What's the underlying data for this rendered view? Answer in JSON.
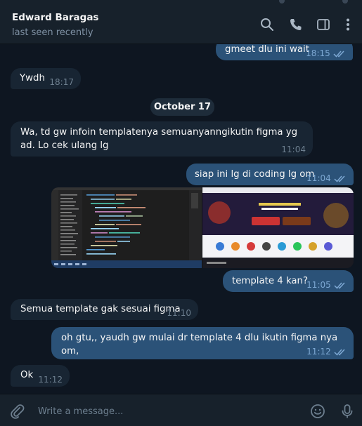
{
  "header": {
    "contact_name": "Edward Baragas",
    "status": "last seen recently",
    "icons": [
      "search-icon",
      "phone-icon",
      "sidebar-toggle-icon",
      "more-vertical-icon"
    ]
  },
  "chat": {
    "date_divider": "October 17",
    "messages": [
      {
        "direction": "outgoing",
        "text": "gmeet dlu ini wait",
        "time": "18:15",
        "read": true
      },
      {
        "direction": "incoming",
        "text": "Ywdh",
        "time": "18:17"
      },
      {
        "direction": "incoming",
        "text": "Wa, td gw infoin templatenya semuanyanngikutin figma yg ad. Lo cek ulang lg",
        "time": "11:04"
      },
      {
        "direction": "outgoing",
        "text": "siap ini lg di coding lg om",
        "time": "11:04",
        "read": true
      },
      {
        "direction": "outgoing",
        "type": "image",
        "description": "two screenshots: code editor and website page"
      },
      {
        "direction": "outgoing",
        "text": "template 4 kan?",
        "time": "11:05",
        "read": true
      },
      {
        "direction": "incoming",
        "text": "Semua template gak sesuai figma",
        "time": "11:10"
      },
      {
        "direction": "outgoing",
        "text": "oh gtu,, yaudh gw mulai dr template 4 dlu ikutin figma nya om,",
        "time": "11:12",
        "read": true
      },
      {
        "direction": "incoming",
        "text": "Ok",
        "time": "11:12"
      }
    ]
  },
  "composer": {
    "placeholder": "Write a message...",
    "icons": [
      "attach-icon",
      "emoji-icon",
      "microphone-icon"
    ]
  },
  "colors": {
    "background": "#0e1621",
    "panel": "#17212b",
    "incoming_bubble": "#182533",
    "outgoing_bubble": "#2b5278",
    "read_checks": "#7da8d3"
  }
}
